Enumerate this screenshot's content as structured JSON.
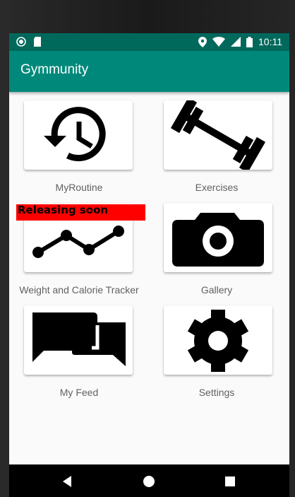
{
  "status_bar": {
    "time": "10:11",
    "left_icons": [
      "record-icon",
      "sd-card-icon"
    ],
    "right_icons": [
      "location-icon",
      "wifi-icon",
      "signal-icon",
      "battery-icon"
    ]
  },
  "app_bar": {
    "title": "Gymmunity"
  },
  "tiles": [
    {
      "label": "MyRoutine",
      "icon": "history-icon"
    },
    {
      "label": "Exercises",
      "icon": "barbell-icon"
    },
    {
      "label": "Weight and Calorie Tracker",
      "icon": "chart-line-icon"
    },
    {
      "label": "Gallery",
      "icon": "camera-icon"
    },
    {
      "label": "My Feed",
      "icon": "chat-icon"
    },
    {
      "label": "Settings",
      "icon": "gear-icon"
    }
  ],
  "badge": {
    "text": "Releasing soon",
    "color": "#ff0000"
  },
  "nav_bar": {
    "buttons": [
      "back-icon",
      "home-icon",
      "recent-apps-icon"
    ]
  },
  "colors": {
    "status_bar": "#00695c",
    "app_bar": "#00897b",
    "background": "#fafafa",
    "label": "#616161"
  }
}
